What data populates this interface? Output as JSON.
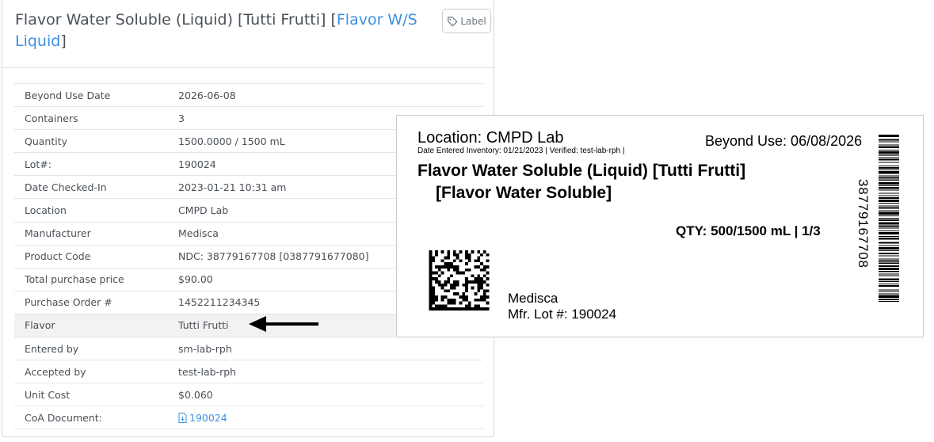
{
  "header": {
    "title_main": "Flavor Water Soluble (Liquid) [Tutti Frutti] [",
    "title_link": "Flavor W/S Liquid",
    "title_close": "]",
    "label_button": "Label"
  },
  "details": [
    {
      "key": "Beyond Use Date",
      "value": "2026-06-08"
    },
    {
      "key": "Containers",
      "value": "3"
    },
    {
      "key": "Quantity",
      "value": "1500.0000 / 1500 mL"
    },
    {
      "key": "Lot#:",
      "value": "190024"
    },
    {
      "key": "Date Checked-In",
      "value": "2023-01-21 10:31 am"
    },
    {
      "key": "Location",
      "value": "CMPD Lab"
    },
    {
      "key": "Manufacturer",
      "value": "Medisca"
    },
    {
      "key": "Product Code",
      "value": "NDC: 38779167708 [0387791677080]"
    },
    {
      "key": "Total purchase price",
      "value": "$90.00"
    },
    {
      "key": "Purchase Order #",
      "value": "1452211234345"
    },
    {
      "key": "Flavor",
      "value": "Tutti Frutti"
    },
    {
      "key": "Entered by",
      "value": "sm-lab-rph"
    },
    {
      "key": "Accepted by",
      "value": "test-lab-rph"
    },
    {
      "key": "Unit Cost",
      "value": "$0.060"
    },
    {
      "key": "CoA Document:",
      "value": "190024"
    }
  ],
  "label_preview": {
    "location": "Location: CMPD Lab",
    "meta": "Date Entered Inventory: 01/21/2023 | Verified: test-lab-rph |",
    "beyond_use": "Beyond Use: 06/08/2026",
    "name_line1": "Flavor Water Soluble (Liquid) [Tutti Frutti]",
    "name_line2": "[Flavor Water Soluble]",
    "qty": "QTY: 500/1500 mL | 1/3",
    "manufacturer": "Medisca",
    "mfr_lot": "Mfr. Lot #: 190024",
    "barcode_number": "38779167708"
  },
  "colors": {
    "link": "#3d8fe0",
    "highlight_row": "#f2f2f2",
    "arrow": "#000000"
  },
  "icons": [
    "tag-icon",
    "document-icon",
    "arrow-left-icon",
    "datamatrix-icon",
    "barcode-icon"
  ]
}
